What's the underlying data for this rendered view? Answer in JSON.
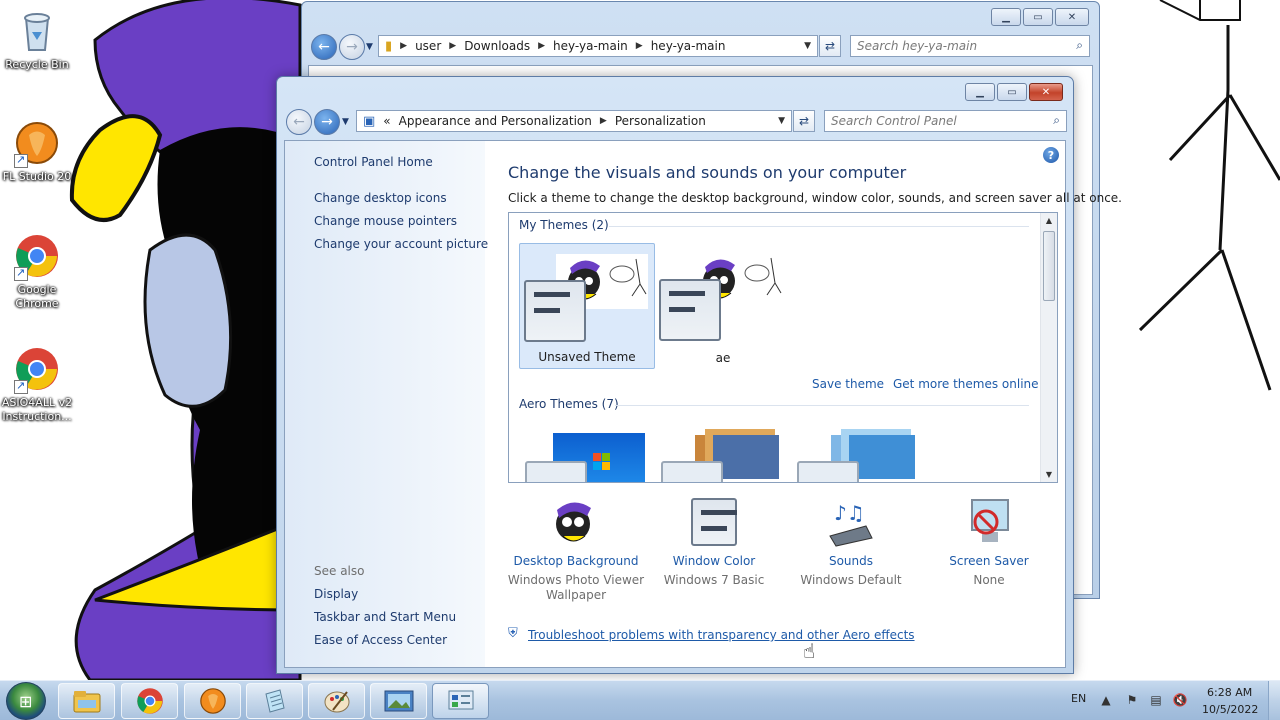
{
  "desktop": {
    "icons": [
      {
        "label": "Recycle Bin",
        "icon": "recycle-bin-icon"
      },
      {
        "label": "FL Studio 20",
        "icon": "fl-studio-icon"
      },
      {
        "label": "Google Chrome",
        "icon": "chrome-icon"
      },
      {
        "label": "ASIO4ALL v2 Instruction...",
        "icon": "chrome-icon"
      }
    ]
  },
  "explorer": {
    "breadcrumb": [
      "user",
      "Downloads",
      "hey-ya-main",
      "hey-ya-main"
    ],
    "search_placeholder": "Search hey-ya-main"
  },
  "control_panel": {
    "breadcrumb": [
      "Appearance and Personalization",
      "Personalization"
    ],
    "breadcrumb_prefix": "«",
    "search_placeholder": "Search Control Panel",
    "left_nav": {
      "home": "Control Panel Home",
      "links": [
        "Change desktop icons",
        "Change mouse pointers",
        "Change your account picture"
      ],
      "see_also_heading": "See also",
      "see_also": [
        "Display",
        "Taskbar and Start Menu",
        "Ease of Access Center"
      ]
    },
    "title": "Change the visuals and sounds on your computer",
    "subtitle": "Click a theme to change the desktop background, window color, sounds, and screen saver all at once.",
    "my_themes_heading": "My Themes (2)",
    "my_themes": [
      {
        "name": "Unsaved Theme",
        "selected": true
      },
      {
        "name": "ae",
        "selected": false
      }
    ],
    "save_theme": "Save theme",
    "get_more": "Get more themes online",
    "aero_heading": "Aero Themes (7)",
    "bottom": [
      {
        "title": "Desktop Background",
        "value": "Windows Photo Viewer Wallpaper"
      },
      {
        "title": "Window Color",
        "value": "Windows 7 Basic"
      },
      {
        "title": "Sounds",
        "value": "Windows Default"
      },
      {
        "title": "Screen Saver",
        "value": "None"
      }
    ],
    "troubleshoot": "Troubleshoot problems with transparency and other Aero effects"
  },
  "taskbar": {
    "apps": [
      "explorer-icon",
      "chrome-icon",
      "fl-studio-icon",
      "notepad-icon",
      "paint-icon",
      "photo-viewer-icon",
      "control-panel-icon"
    ],
    "language": "EN",
    "time": "6:28 AM",
    "date": "10/5/2022"
  },
  "colors": {
    "link": "#1e5aa8",
    "heading": "#1e3b6e",
    "taskbar": "#a9c3e0",
    "close_red": "#c3432a"
  }
}
